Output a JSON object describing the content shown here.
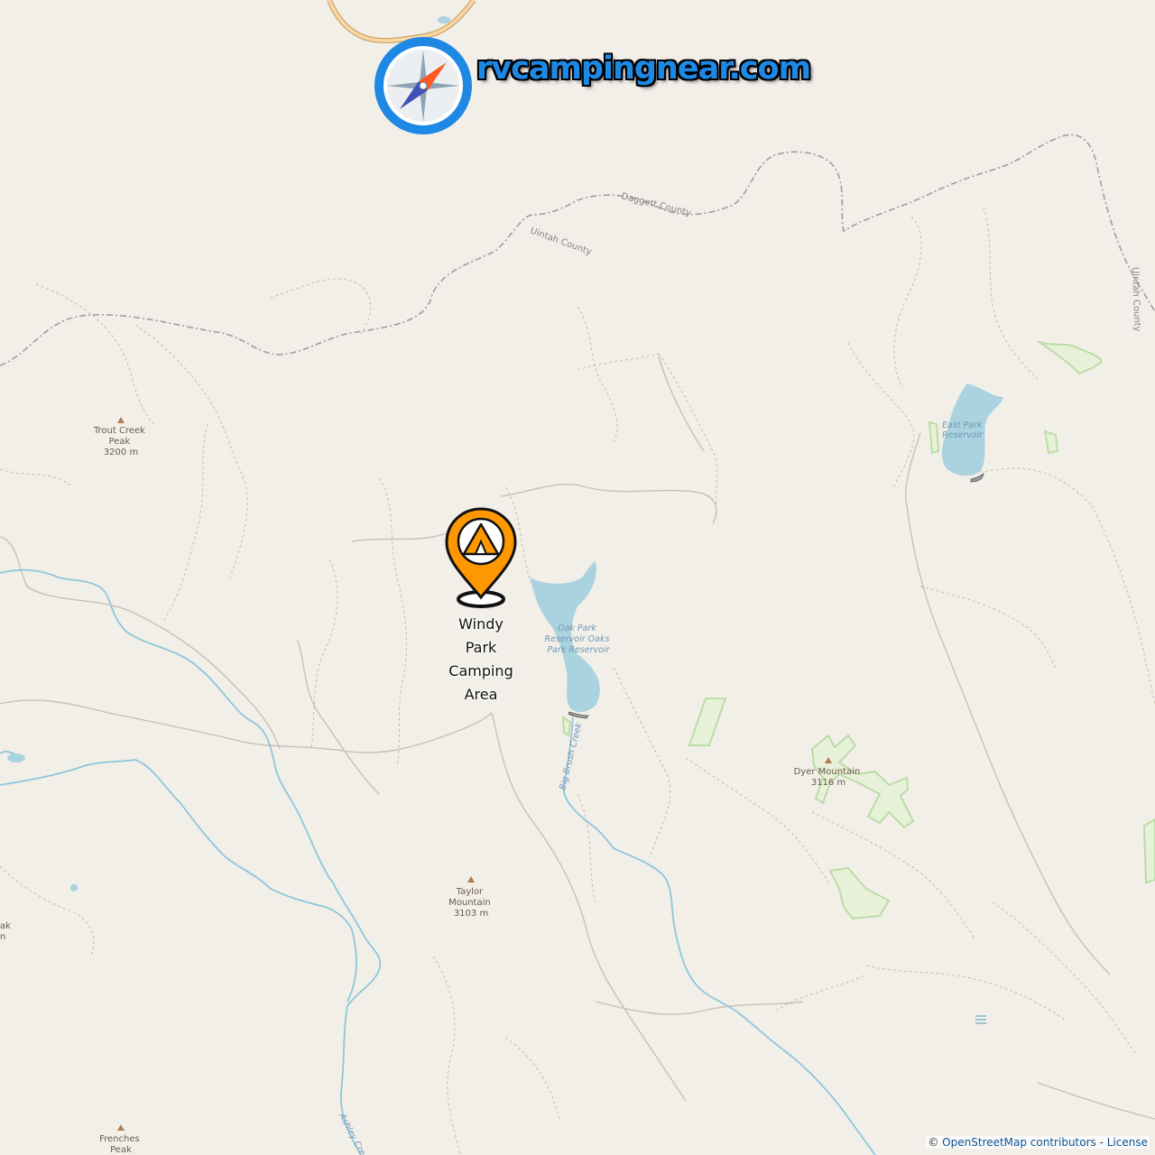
{
  "brand": {
    "text": "rvcampingnear.com",
    "logo_icon": "compass-icon",
    "color": "#1e88e5"
  },
  "campsite": {
    "label_lines": [
      "Windy",
      "Park",
      "Camping",
      "Area"
    ],
    "icon": "tent-map-pin-icon",
    "pin_color": "#ff9800"
  },
  "peaks": [
    {
      "name": "Trout Creek",
      "name2": "Peak",
      "elevation": "3200 m"
    },
    {
      "name": "Taylor",
      "name2": "Mountain",
      "elevation": "3103 m"
    },
    {
      "name": "Dyer Mountain",
      "name2": "",
      "elevation": "3116 m"
    },
    {
      "name": "Frenches",
      "name2": "Peak",
      "elevation": ""
    }
  ],
  "water": {
    "oak_park": [
      "Oak Park",
      "Reservoir Oaks",
      "Park Reservoir"
    ],
    "east_park": [
      "East Park",
      "Reservoir"
    ],
    "creek_big_brush": "Big Brush Creek",
    "creek_ashley": "Ashley Creek"
  },
  "counties": {
    "daggett": "Daggett County",
    "uintah_1": "Uintah County",
    "uintah_2": "Uintah County"
  },
  "edge_fragments": [
    "ak",
    "n"
  ],
  "attribution": {
    "prefix": "© ",
    "osm": "OpenStreetMap contributors",
    "sep": " - ",
    "license": "License"
  },
  "colors": {
    "land": "#f2efe9",
    "water": "#aad3df",
    "river": "#8fc6da",
    "park_outline": "#b7dba0"
  }
}
